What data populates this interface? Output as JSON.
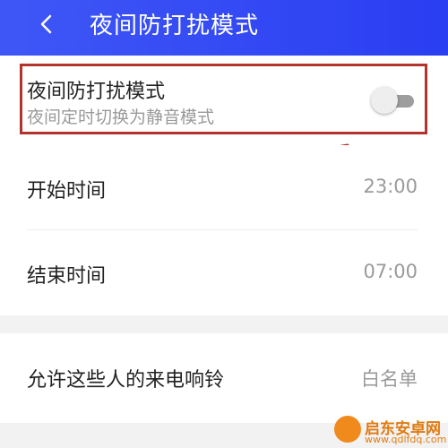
{
  "header": {
    "title": "夜间防打扰模式"
  },
  "dnd": {
    "title": "夜间防打扰模式",
    "subtitle": "夜间定时切换为静音模式",
    "enabled": false
  },
  "schedule": {
    "start_label": "开始时间",
    "start_value": "23:00",
    "end_label": "结束时间",
    "end_value": "07:00"
  },
  "allow": {
    "label": "允许这些人的来电响铃",
    "value": "白名单"
  },
  "watermark": {
    "text": "启东安卓网",
    "url": "www.qdlfdq.com"
  },
  "colors": {
    "header": "#3f57f6",
    "highlight": "#b3322b"
  }
}
